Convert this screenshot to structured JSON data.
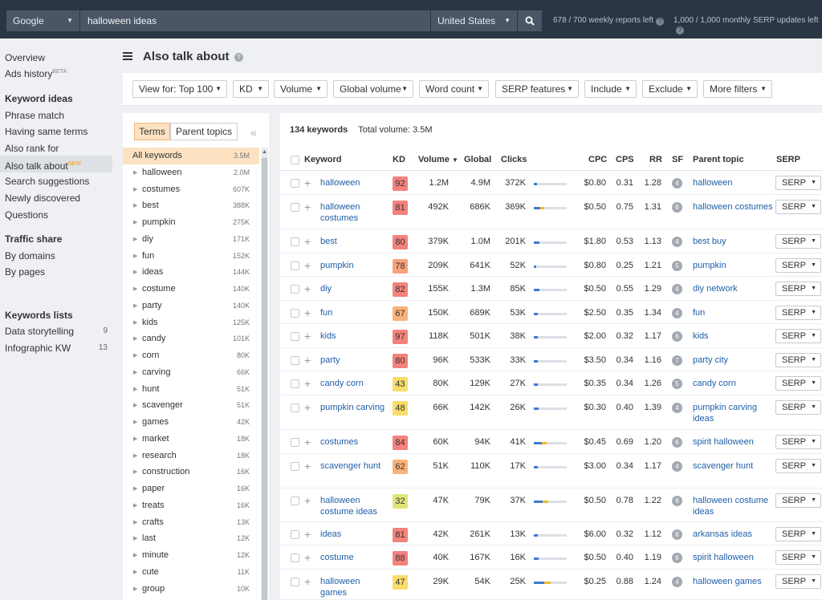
{
  "topbar": {
    "engine": "Google",
    "query": "halloween ideas",
    "country": "United States",
    "weekly_quota": "678 / 700 weekly reports left",
    "serp_quota": "1,000 / 1,000 monthly SERP updates left"
  },
  "nav": {
    "overview": "Overview",
    "ads_history": "Ads history",
    "ads_history_badge": "BETA",
    "keyword_ideas_head": "Keyword ideas",
    "phrase_match": "Phrase match",
    "same_terms": "Having same terms",
    "also_rank": "Also rank for",
    "also_talk": "Also talk about",
    "also_talk_badge": "NEW",
    "search_suggestions": "Search suggestions",
    "newly_discovered": "Newly discovered",
    "questions": "Questions",
    "traffic_share_head": "Traffic share",
    "by_domains": "By domains",
    "by_pages": "By pages",
    "keywords_lists_head": "Keywords lists",
    "lists": [
      {
        "name": "Data storytelling",
        "count": "9"
      },
      {
        "name": "Infographic KW",
        "count": "13"
      }
    ]
  },
  "page": {
    "title": "Also talk about"
  },
  "filters": [
    "View for: Top 100",
    "KD",
    "Volume",
    "Global volume",
    "Word count",
    "SERP features",
    "Include",
    "Exclude",
    "More filters"
  ],
  "terms_panel": {
    "tab_terms": "Terms",
    "tab_parent": "Parent topics",
    "all": {
      "name": "All keywords",
      "count": "3.5M"
    },
    "items": [
      {
        "name": "halloween",
        "count": "2.0M"
      },
      {
        "name": "costumes",
        "count": "607K"
      },
      {
        "name": "best",
        "count": "388K"
      },
      {
        "name": "pumpkin",
        "count": "275K"
      },
      {
        "name": "diy",
        "count": "171K"
      },
      {
        "name": "fun",
        "count": "152K"
      },
      {
        "name": "ideas",
        "count": "144K"
      },
      {
        "name": "costume",
        "count": "140K"
      },
      {
        "name": "party",
        "count": "140K"
      },
      {
        "name": "kids",
        "count": "125K"
      },
      {
        "name": "candy",
        "count": "101K"
      },
      {
        "name": "corn",
        "count": "80K"
      },
      {
        "name": "carving",
        "count": "66K"
      },
      {
        "name": "hunt",
        "count": "51K"
      },
      {
        "name": "scavenger",
        "count": "51K"
      },
      {
        "name": "games",
        "count": "42K"
      },
      {
        "name": "market",
        "count": "18K"
      },
      {
        "name": "research",
        "count": "18K"
      },
      {
        "name": "construction",
        "count": "16K"
      },
      {
        "name": "paper",
        "count": "16K"
      },
      {
        "name": "treats",
        "count": "16K"
      },
      {
        "name": "crafts",
        "count": "13K"
      },
      {
        "name": "last",
        "count": "12K"
      },
      {
        "name": "minute",
        "count": "12K"
      },
      {
        "name": "cute",
        "count": "11K"
      },
      {
        "name": "group",
        "count": "10K"
      }
    ]
  },
  "table": {
    "count_label": "134 keywords",
    "volume_label": "Total volume: 3.5M",
    "headers": {
      "keyword": "Keyword",
      "kd": "KD",
      "volume": "Volume",
      "global": "Global",
      "clicks": "Clicks",
      "cpc": "CPC",
      "cps": "CPS",
      "rr": "RR",
      "sf": "SF",
      "parent": "Parent topic",
      "serp": "SERP"
    },
    "serp_label": "SERP",
    "rows": [
      {
        "keyword": "halloween",
        "kd": "92",
        "kd_color": "#f4827c",
        "volume": "1.2M",
        "global": "4.9M",
        "clicks": "372K",
        "clicks_ratio": 0.3,
        "cpc": "$0.80",
        "cps": "0.31",
        "rr": "1.28",
        "sf": "4",
        "parent": "halloween"
      },
      {
        "keyword": "halloween costumes",
        "kd": "81",
        "kd_color": "#f4827c",
        "volume": "492K",
        "global": "686K",
        "clicks": "369K",
        "clicks_ratio": 0.55,
        "cpc": "$0.50",
        "cps": "0.75",
        "rr": "1.31",
        "sf": "6",
        "parent": "halloween costumes"
      },
      {
        "keyword": "best",
        "kd": "80",
        "kd_color": "#f4827c",
        "volume": "379K",
        "global": "1.0M",
        "clicks": "201K",
        "clicks_ratio": 0.5,
        "cpc": "$1.80",
        "cps": "0.53",
        "rr": "1.13",
        "sf": "4",
        "parent": "best buy"
      },
      {
        "keyword": "pumpkin",
        "kd": "78",
        "kd_color": "#f8a17a",
        "volume": "209K",
        "global": "641K",
        "clicks": "52K",
        "clicks_ratio": 0.22,
        "cpc": "$0.80",
        "cps": "0.25",
        "rr": "1.21",
        "sf": "5",
        "parent": "pumpkin"
      },
      {
        "keyword": "diy",
        "kd": "82",
        "kd_color": "#f4827c",
        "volume": "155K",
        "global": "1.3M",
        "clicks": "85K",
        "clicks_ratio": 0.5,
        "cpc": "$0.50",
        "cps": "0.55",
        "rr": "1.29",
        "sf": "4",
        "parent": "diy network"
      },
      {
        "keyword": "fun",
        "kd": "67",
        "kd_color": "#f9b27a",
        "volume": "150K",
        "global": "689K",
        "clicks": "53K",
        "clicks_ratio": 0.35,
        "cpc": "$2.50",
        "cps": "0.35",
        "rr": "1.34",
        "sf": "4",
        "parent": "fun"
      },
      {
        "keyword": "kids",
        "kd": "97",
        "kd_color": "#f4827c",
        "volume": "118K",
        "global": "501K",
        "clicks": "38K",
        "clicks_ratio": 0.32,
        "cpc": "$2.00",
        "cps": "0.32",
        "rr": "1.17",
        "sf": "6",
        "parent": "kids"
      },
      {
        "keyword": "party",
        "kd": "80",
        "kd_color": "#f4827c",
        "volume": "96K",
        "global": "533K",
        "clicks": "33K",
        "clicks_ratio": 0.34,
        "cpc": "$3.50",
        "cps": "0.34",
        "rr": "1.16",
        "sf": "7",
        "parent": "party city"
      },
      {
        "keyword": "candy corn",
        "kd": "43",
        "kd_color": "#f8dd6a",
        "volume": "80K",
        "global": "129K",
        "clicks": "27K",
        "clicks_ratio": 0.34,
        "cpc": "$0.35",
        "cps": "0.34",
        "rr": "1.26",
        "sf": "5",
        "parent": "candy corn"
      },
      {
        "keyword": "pumpkin carving",
        "kd": "48",
        "kd_color": "#f8dd6a",
        "volume": "66K",
        "global": "142K",
        "clicks": "26K",
        "clicks_ratio": 0.4,
        "cpc": "$0.30",
        "cps": "0.40",
        "rr": "1.39",
        "sf": "4",
        "parent": "pumpkin carving ideas"
      },
      {
        "keyword": "costumes",
        "kd": "84",
        "kd_color": "#f4827c",
        "volume": "60K",
        "global": "94K",
        "clicks": "41K",
        "clicks_ratio": 0.69,
        "cpc": "$0.45",
        "cps": "0.69",
        "rr": "1.20",
        "sf": "6",
        "parent": "spirit halloween"
      },
      {
        "keyword": "scavenger hunt",
        "kd": "62",
        "kd_color": "#f9b27a",
        "volume": "51K",
        "global": "110K",
        "clicks": "17K",
        "clicks_ratio": 0.34,
        "cpc": "$3.00",
        "cps": "0.34",
        "rr": "1.17",
        "sf": "4",
        "parent": "scavenger hunt"
      },
      {
        "keyword": "halloween costume ideas",
        "kd": "32",
        "kd_color": "#dfe57a",
        "volume": "47K",
        "global": "79K",
        "clicks": "37K",
        "clicks_ratio": 0.78,
        "cpc": "$0.50",
        "cps": "0.78",
        "rr": "1.22",
        "sf": "6",
        "parent": "halloween costume ideas"
      },
      {
        "keyword": "ideas",
        "kd": "81",
        "kd_color": "#f4827c",
        "volume": "42K",
        "global": "261K",
        "clicks": "13K",
        "clicks_ratio": 0.32,
        "cpc": "$6.00",
        "cps": "0.32",
        "rr": "1.12",
        "sf": "6",
        "parent": "arkansas ideas"
      },
      {
        "keyword": "costume",
        "kd": "88",
        "kd_color": "#f4827c",
        "volume": "40K",
        "global": "167K",
        "clicks": "16K",
        "clicks_ratio": 0.4,
        "cpc": "$0.50",
        "cps": "0.40",
        "rr": "1.19",
        "sf": "6",
        "parent": "spirit halloween"
      },
      {
        "keyword": "halloween games",
        "kd": "47",
        "kd_color": "#f8dd6a",
        "volume": "29K",
        "global": "54K",
        "clicks": "25K",
        "clicks_ratio": 0.88,
        "cpc": "$0.25",
        "cps": "0.88",
        "rr": "1.24",
        "sf": "4",
        "parent": "halloween games"
      }
    ]
  }
}
